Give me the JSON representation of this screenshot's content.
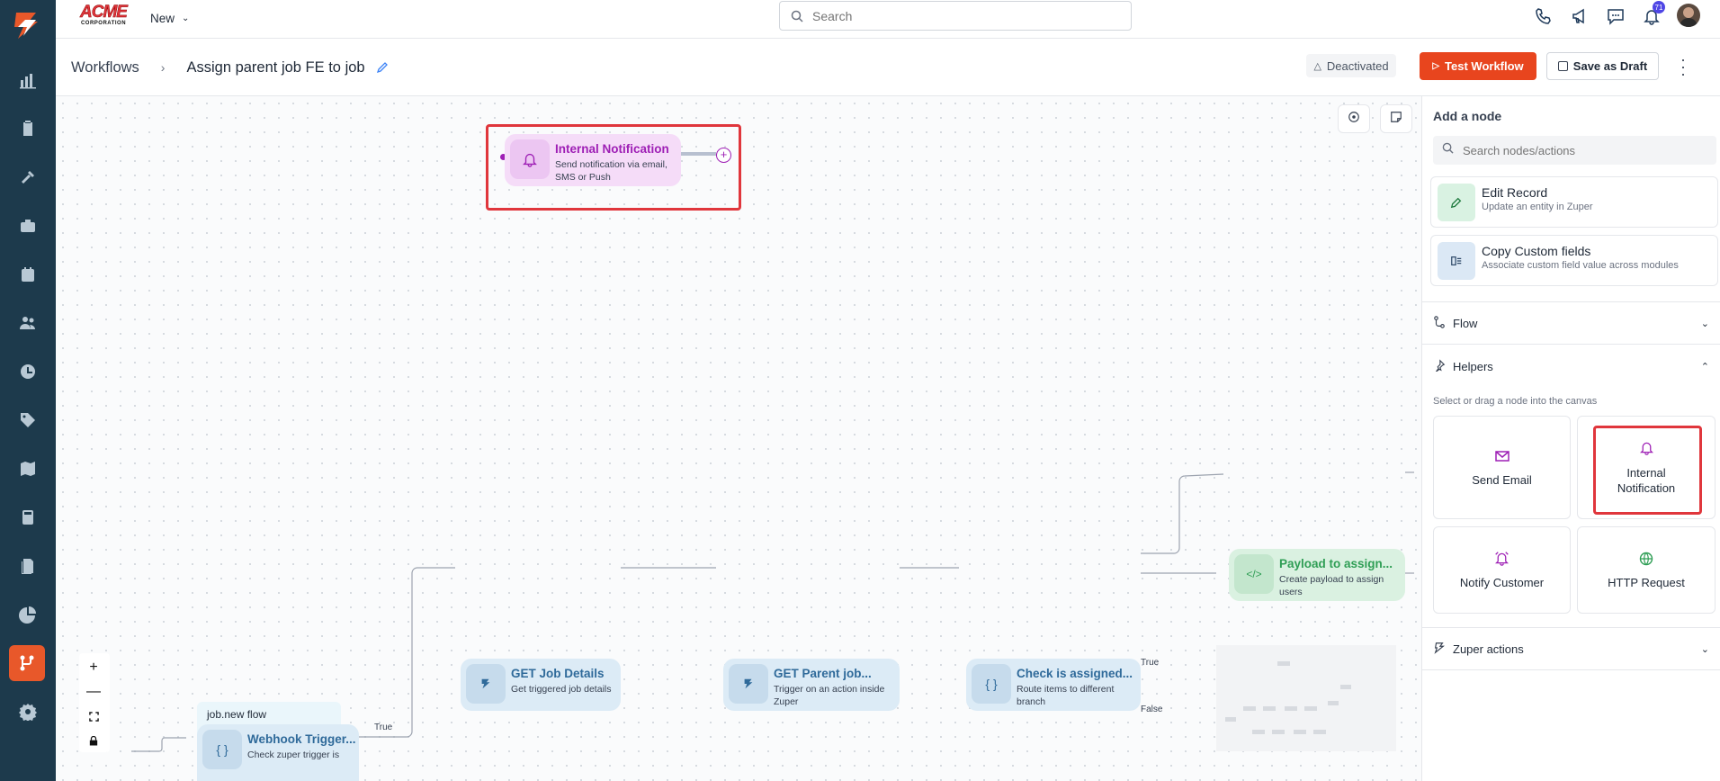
{
  "app": {
    "logo_text": "ACME",
    "logo_sub": "CORPORATION",
    "new_label": "New"
  },
  "search": {
    "placeholder": "Search"
  },
  "notifications": {
    "count": "71"
  },
  "breadcrumb": {
    "root": "Workflows",
    "title": "Assign parent job FE to job"
  },
  "header": {
    "status": "Deactivated",
    "test_label": "Test Workflow",
    "draft_label": "Save as Draft"
  },
  "nodes": {
    "notification": {
      "title": "Internal Notification",
      "sub": "Send notification via email, SMS or Push"
    },
    "webhook": {
      "group": "job.new flow",
      "title": "Webhook Trigger...",
      "sub": "Check zuper trigger is"
    },
    "get_job": {
      "title": "GET Job Details",
      "sub": "Get triggered job details"
    },
    "get_parent": {
      "title": "GET Parent job...",
      "sub": "Trigger on an action inside Zuper"
    },
    "check": {
      "title": "Check is assigned...",
      "sub": "Route items to different branch"
    },
    "payload": {
      "title": "Payload to assign...",
      "sub": "Create payload to assign users"
    }
  },
  "edges": {
    "true1": "True",
    "true2": "True",
    "false1": "False"
  },
  "panel": {
    "title": "Add a node",
    "search_placeholder": "Search nodes/actions",
    "edit_record": {
      "title": "Edit Record",
      "sub": "Update an entity in Zuper"
    },
    "copy_fields": {
      "title": "Copy Custom fields",
      "sub": "Associate custom field value across modules"
    },
    "flow_label": "Flow",
    "helpers_label": "Helpers",
    "helpers_hint": "Select or drag a node into the canvas",
    "tiles": {
      "send_email": "Send Email",
      "internal_notification": "Internal Notification",
      "notify_customer": "Notify Customer",
      "http_request": "HTTP Request"
    },
    "zuper_actions": "Zuper actions"
  },
  "colors": {
    "sidebar": "#1d3a4c",
    "accent": "#e8582a",
    "highlight": "#e0363c",
    "purple": "#9e1fb5"
  }
}
